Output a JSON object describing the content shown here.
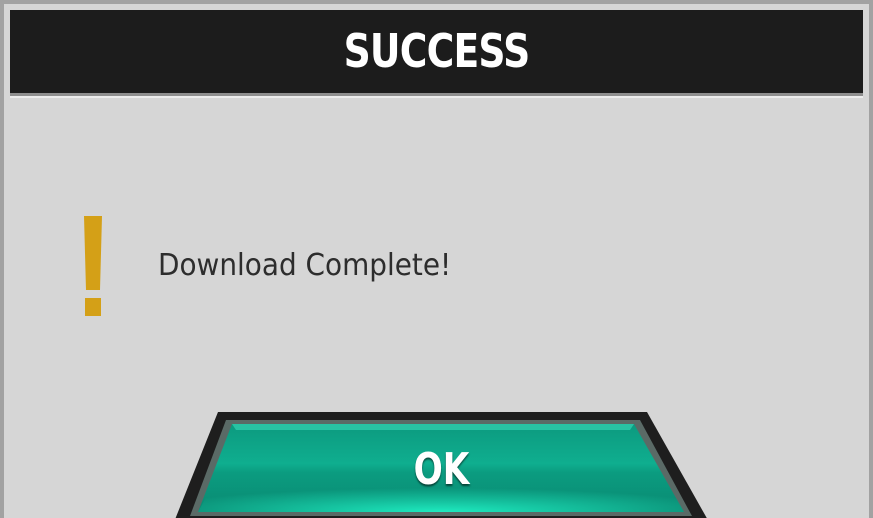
{
  "dialog": {
    "title": "SUCCESS",
    "message": "Download Complete!",
    "icon": "exclamation-icon",
    "ok_label": "OK"
  },
  "colors": {
    "title_bar": "#1c1c1c",
    "panel": "#d6d6d6",
    "icon": "#d4a017",
    "button_teal": "#12c9a4",
    "button_border": "#2a2a2a"
  }
}
